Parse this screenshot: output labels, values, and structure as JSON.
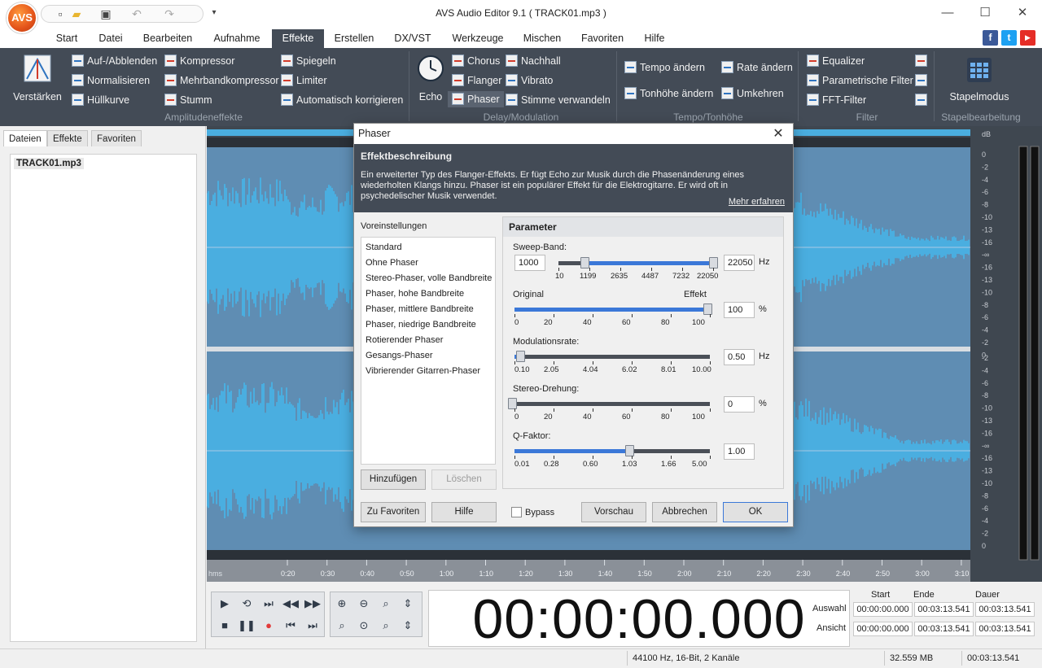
{
  "titlebar": {
    "app_logo": "AVS",
    "title": "AVS Audio Editor 9.1  ( TRACK01.mp3 )",
    "minimize": "—",
    "maximize": "☐",
    "close": "✕"
  },
  "tabs": [
    "Start",
    "Datei",
    "Bearbeiten",
    "Aufnahme",
    "Effekte",
    "Erstellen",
    "DX/VST",
    "Werkzeuge",
    "Mischen",
    "Favoriten",
    "Hilfe"
  ],
  "active_tab": "Effekte",
  "social": {
    "facebook": "f",
    "twitter": "t",
    "youtube": "▶"
  },
  "ribbon": {
    "verstaerken": "Verstärken",
    "amp_items": [
      "Auf-/Abblenden",
      "Normalisieren",
      "Hüllkurve"
    ],
    "amp_items2": [
      "Kompressor",
      "Mehrbandkompressor",
      "Stumm"
    ],
    "amp_items3": [
      "Spiegeln",
      "Limiter",
      "Automatisch korrigieren"
    ],
    "group_amp": "Amplitudeneffekte",
    "echo": "Echo",
    "delay_items": [
      "Chorus",
      "Flanger",
      "Phaser"
    ],
    "delay_items2": [
      "Nachhall",
      "Vibrato",
      "Stimme verwandeln"
    ],
    "group_delay": "Delay/Modulation",
    "tempo_items": [
      "Tempo ändern",
      "Tonhöhe ändern"
    ],
    "tempo_items2": [
      "Rate ändern",
      "Umkehren"
    ],
    "group_tempo": "Tempo/Tonhöhe",
    "filter_items": [
      "Equalizer",
      "Parametrische Filter",
      "FFT-Filter"
    ],
    "group_filter": "Filter",
    "stapelmodus": "Stapelmodus",
    "group_batch": "Stapelbearbeitung"
  },
  "left_panel": {
    "tabs": [
      "Dateien",
      "Effekte",
      "Favoriten"
    ],
    "file": "TRACK01.mp3"
  },
  "waveform": {
    "db_unit": "dB",
    "db_labels": [
      "0",
      "-2",
      "-4",
      "-6",
      "-8",
      "-10",
      "-13",
      "-16",
      "-∞",
      "-16",
      "-13",
      "-10",
      "-8",
      "-6",
      "-4",
      "-2",
      "0"
    ],
    "db_labels2": [
      "-2",
      "-4",
      "-6",
      "-8",
      "-10",
      "-13",
      "-16",
      "-∞",
      "-16",
      "-13",
      "-10",
      "-8",
      "-6",
      "-4",
      "-2",
      "0"
    ],
    "time_unit": "hms",
    "time_labels": [
      "0:20",
      "0:30",
      "0:40",
      "0:50",
      "1:00",
      "1:10",
      "1:20",
      "1:30",
      "1:40",
      "1:50",
      "2:00",
      "2:10",
      "2:20",
      "2:30",
      "2:40",
      "2:50",
      "3:00",
      "3:10"
    ],
    "wave_color": "#4aaee0"
  },
  "transport": {
    "big_time": "00:00:00.000",
    "col_start": "Start",
    "col_end": "Ende",
    "col_duration": "Dauer",
    "row_selection": "Auswahl",
    "row_view": "Ansicht",
    "sel_values": [
      "00:00:00.000",
      "00:03:13.541",
      "00:03:13.541"
    ],
    "view_values": [
      "00:00:00.000",
      "00:03:13.541",
      "00:03:13.541"
    ]
  },
  "status": {
    "format": "44100 Hz, 16-Bit, 2 Kanäle",
    "size": "32.559 MB",
    "duration": "00:03:13.541"
  },
  "dialog": {
    "title": "Phaser",
    "desc_heading": "Effektbeschreibung",
    "desc_text": "Ein erweiterter Typ des Flanger-Effekts. Er fügt Echo zur Musik durch die Phasenänderung eines wiederholten Klangs hinzu. Phaser ist ein populärer Effekt für die Elektrogitarre. Er wird oft in psychedelischer Musik verwendet.",
    "more_link": "Mehr erfahren",
    "presets_label": "Voreinstellungen",
    "presets": [
      "Standard",
      "Ohne Phaser",
      "Stereo-Phaser, volle Bandbreite",
      "Phaser, hohe Bandbreite",
      "Phaser, mittlere Bandbreite",
      "Phaser, niedrige Bandbreite",
      "Rotierender Phaser",
      "Gesangs-Phaser",
      "Vibrierender Gitarren-Phaser"
    ],
    "add_btn": "Hinzufügen",
    "delete_btn": "Löschen",
    "params_title": "Parameter",
    "sweep": {
      "label": "Sweep-Band:",
      "low": "1000",
      "high": "22050",
      "unit": "Hz",
      "ticks": [
        "10",
        "1199",
        "2635",
        "4487",
        "7232",
        "22050"
      ],
      "low_value": 1000,
      "high_value": 22050,
      "max": 22050
    },
    "mix": {
      "label_left": "Original",
      "label_right": "Effekt",
      "value": "100",
      "unit": "%",
      "ticks": [
        "0",
        "20",
        "40",
        "60",
        "80",
        "100"
      ],
      "fraction": 1.0
    },
    "modrate": {
      "label": "Modulationsrate:",
      "value": "0.50",
      "unit": "Hz",
      "ticks": [
        "0.10",
        "2.05",
        "4.04",
        "6.02",
        "8.01",
        "10.00"
      ],
      "fraction": 0.04
    },
    "stereo": {
      "label": "Stereo-Drehung:",
      "value": "0",
      "unit": "%",
      "ticks": [
        "0",
        "20",
        "40",
        "60",
        "80",
        "100"
      ],
      "fraction": 0.0
    },
    "qfactor": {
      "label": "Q-Faktor:",
      "value": "1.00",
      "ticks": [
        "0.01",
        "0.28",
        "0.60",
        "1.03",
        "1.66",
        "5.00"
      ],
      "fraction": 0.6
    },
    "fav_btn": "Zu Favoriten",
    "help_btn": "Hilfe",
    "bypass": "Bypass",
    "preview_btn": "Vorschau",
    "cancel_btn": "Abbrechen",
    "ok_btn": "OK"
  }
}
